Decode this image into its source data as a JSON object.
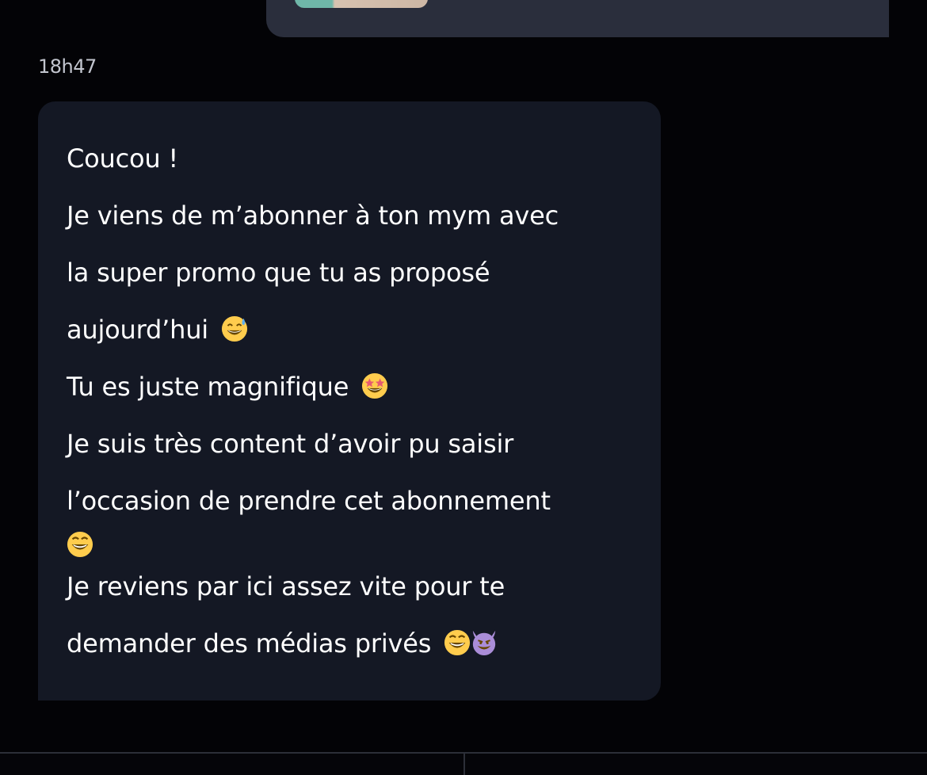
{
  "conversation": {
    "timestamp": "18h47",
    "message": {
      "lines": [
        "Coucou !",
        "Je viens de m’abonner à ton mym avec",
        "la super promo que tu as proposé",
        "aujourd’hui",
        "Tu es juste magnifique",
        "Je suis très content d’avoir pu saisir",
        "l’occasion de prendre cet abonnement",
        "Je reviens par ici assez vite pour te",
        "demander des médias privés"
      ],
      "emojis": {
        "line_4": "sweat-smile-emoji",
        "line_5": "star-struck-emoji",
        "line_7_wrap": "grinning-squinting-emoji",
        "line_9": [
          "grinning-squinting-emoji",
          "smiling-devil-emoji"
        ]
      }
    }
  },
  "colors": {
    "background": "#030306",
    "incoming_bubble": "#141824",
    "outgoing_bubble": "#2a2e3c",
    "text": "#ffffff",
    "timestamp": "#c2c5ce"
  }
}
